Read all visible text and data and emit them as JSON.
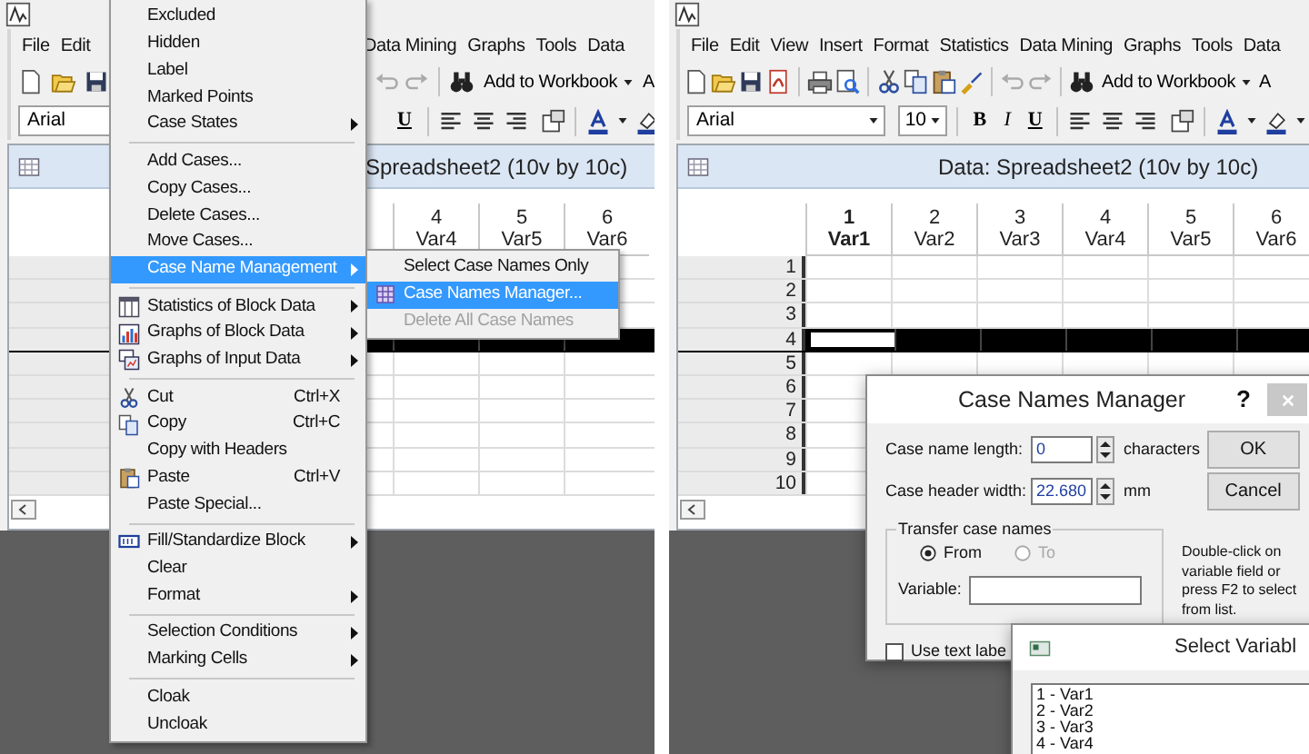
{
  "left_screen": {
    "menu_bar_left": [
      {
        "label": "File"
      },
      {
        "label": "Edit"
      }
    ],
    "menu_bar_right": [
      {
        "label": "Data Mining"
      },
      {
        "label": "Graphs"
      },
      {
        "label": "Tools"
      },
      {
        "label": "Data"
      }
    ],
    "toolbar": {
      "add_button": "Add to Workbook",
      "cut_button": "A"
    },
    "format_toolbar": {
      "font": "Arial",
      "style_buttons": [
        {
          "label": "U",
          "kind": "underline"
        }
      ]
    },
    "spreadsheet": {
      "title": "Spreadsheet2 (10v by 10c)",
      "columns": [
        {
          "number": "4",
          "name": "Var4",
          "selected": false
        },
        {
          "number": "5",
          "name": "Var5",
          "selected": false
        },
        {
          "number": "6",
          "name": "Var6",
          "selected": false
        }
      ],
      "rows": [
        {
          "selected": false
        },
        {
          "selected": false
        },
        {
          "selected": false
        },
        {
          "selected": true
        },
        {
          "selected": false
        },
        {
          "selected": false
        },
        {
          "selected": false
        },
        {
          "selected": false
        },
        {
          "selected": false
        },
        {
          "selected": false
        }
      ]
    },
    "context_menu": [
      {
        "kind": "item",
        "label": "Excluded",
        "submenu": false,
        "icon": false,
        "selected": false
      },
      {
        "kind": "item",
        "label": "Hidden",
        "submenu": false,
        "icon": false,
        "selected": false
      },
      {
        "kind": "item",
        "label": "Label",
        "submenu": false,
        "icon": false,
        "selected": false
      },
      {
        "kind": "item",
        "label": "Marked Points",
        "submenu": false,
        "icon": false,
        "selected": false
      },
      {
        "kind": "item",
        "label": "Case States",
        "submenu": true,
        "icon": false,
        "selected": false
      },
      {
        "kind": "separator"
      },
      {
        "kind": "item",
        "label": "Add Cases...",
        "submenu": false,
        "icon": false,
        "selected": false
      },
      {
        "kind": "item",
        "label": "Copy Cases...",
        "submenu": false,
        "icon": false,
        "selected": false
      },
      {
        "kind": "item",
        "label": "Delete Cases...",
        "submenu": false,
        "icon": false,
        "selected": false
      },
      {
        "kind": "item",
        "label": "Move Cases...",
        "submenu": false,
        "icon": false,
        "selected": false
      },
      {
        "kind": "item",
        "label": "Case Name Management",
        "submenu": true,
        "icon": false,
        "selected": true
      },
      {
        "kind": "separator"
      },
      {
        "kind": "item",
        "label": "Statistics of Block Data",
        "submenu": true,
        "icon": true,
        "selected": false
      },
      {
        "kind": "item",
        "label": "Graphs of Block Data",
        "submenu": true,
        "icon": true,
        "selected": false
      },
      {
        "kind": "item",
        "label": "Graphs of Input Data",
        "submenu": true,
        "icon": true,
        "selected": false
      },
      {
        "kind": "separator"
      },
      {
        "kind": "item",
        "label": "Cut",
        "shortcut": "Ctrl+X",
        "submenu": false,
        "icon": true,
        "selected": false
      },
      {
        "kind": "item",
        "label": "Copy",
        "shortcut": "Ctrl+C",
        "submenu": false,
        "icon": true,
        "selected": false
      },
      {
        "kind": "item",
        "label": "Copy with Headers",
        "submenu": false,
        "icon": false,
        "selected": false
      },
      {
        "kind": "item",
        "label": "Paste",
        "shortcut": "Ctrl+V",
        "submenu": false,
        "icon": true,
        "selected": false
      },
      {
        "kind": "item",
        "label": "Paste Special...",
        "submenu": false,
        "icon": false,
        "selected": false
      },
      {
        "kind": "separator"
      },
      {
        "kind": "item",
        "label": "Fill/Standardize Block",
        "submenu": true,
        "icon": true,
        "selected": false
      },
      {
        "kind": "item",
        "label": "Clear",
        "submenu": false,
        "icon": false,
        "selected": false
      },
      {
        "kind": "item",
        "label": "Format",
        "submenu": true,
        "icon": false,
        "selected": false
      },
      {
        "kind": "separator"
      },
      {
        "kind": "item",
        "label": "Selection Conditions",
        "submenu": true,
        "icon": false,
        "selected": false
      },
      {
        "kind": "item",
        "label": "Marking Cells",
        "submenu": true,
        "icon": false,
        "selected": false
      },
      {
        "kind": "separator"
      },
      {
        "kind": "item",
        "label": "Cloak",
        "submenu": false,
        "icon": false,
        "selected": false
      },
      {
        "kind": "item",
        "label": "Uncloak",
        "submenu": false,
        "icon": false,
        "selected": false
      }
    ],
    "submenu": [
      {
        "label": "Select Case Names Only",
        "icon": false,
        "selected": false,
        "disabled": false
      },
      {
        "label": "Case Names Manager...",
        "icon": true,
        "selected": true,
        "disabled": false
      },
      {
        "label": "Delete All Case Names",
        "icon": false,
        "selected": false,
        "disabled": true
      }
    ]
  },
  "right_screen": {
    "menu_bar": [
      {
        "label": "File"
      },
      {
        "label": "Edit"
      },
      {
        "label": "View"
      },
      {
        "label": "Insert"
      },
      {
        "label": "Format"
      },
      {
        "label": "Statistics"
      },
      {
        "label": "Data Mining"
      },
      {
        "label": "Graphs"
      },
      {
        "label": "Tools"
      },
      {
        "label": "Data"
      }
    ],
    "toolbar": {
      "add_button": "Add to Workbook",
      "cut_button": "A"
    },
    "format_toolbar": {
      "font": "Arial",
      "size": "10",
      "style_buttons": [
        {
          "label": "B",
          "kind": "bold"
        },
        {
          "label": "I",
          "kind": "italic"
        },
        {
          "label": "U",
          "kind": "underline"
        }
      ]
    },
    "spreadsheet": {
      "title": "Data: Spreadsheet2 (10v by 10c)",
      "columns": [
        {
          "number": "1",
          "name": "Var1",
          "selected": true
        },
        {
          "number": "2",
          "name": "Var2",
          "selected": false
        },
        {
          "number": "3",
          "name": "Var3",
          "selected": false
        },
        {
          "number": "4",
          "name": "Var4",
          "selected": false
        },
        {
          "number": "5",
          "name": "Var5",
          "selected": false
        },
        {
          "number": "6",
          "name": "Var6",
          "selected": false
        }
      ],
      "rows": [
        {
          "number": "1",
          "selected": false
        },
        {
          "number": "2",
          "selected": false
        },
        {
          "number": "3",
          "selected": false
        },
        {
          "number": "4",
          "selected": true
        },
        {
          "number": "5",
          "selected": false
        },
        {
          "number": "6",
          "selected": false
        },
        {
          "number": "7",
          "selected": false
        },
        {
          "number": "8",
          "selected": false
        },
        {
          "number": "9",
          "selected": false
        },
        {
          "number": "10",
          "selected": false
        }
      ]
    },
    "dialog": {
      "title": "Case Names Manager",
      "help": "?",
      "fields": [
        {
          "label": "Case name length:",
          "value": "0",
          "unit": "characters"
        },
        {
          "label": "Case header width:",
          "value": "22.680",
          "unit": "mm"
        }
      ],
      "buttons": [
        "OK",
        "Cancel"
      ],
      "transfer": {
        "legend": "Transfer case names",
        "options": [
          {
            "label": "From",
            "selected": true,
            "disabled": false
          },
          {
            "label": "To",
            "selected": false,
            "disabled": true
          }
        ],
        "variable_label": "Variable:"
      },
      "hint": "Double-click on variable field or press F2 to select from list.",
      "use_text_labels": {
        "label": "Use text labe",
        "checked": false
      }
    },
    "select_variables": {
      "title": "Select Variabl",
      "items": [
        "1 - Var1",
        "2 - Var2",
        "3 - Var3",
        "4 - Var4"
      ]
    }
  }
}
